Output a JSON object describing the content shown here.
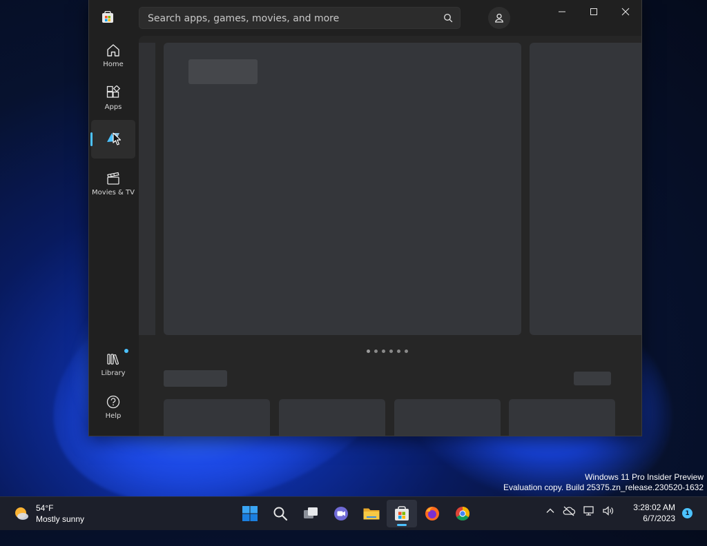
{
  "search": {
    "placeholder": "Search apps, games, movies, and more"
  },
  "sidebar": {
    "items": [
      {
        "label": "Home",
        "icon": "home-icon"
      },
      {
        "label": "Apps",
        "icon": "apps-icon"
      },
      {
        "label": "",
        "icon": "gaming-icon",
        "active": true
      },
      {
        "label": "Movies & TV",
        "icon": "movies-icon"
      }
    ],
    "bottom": [
      {
        "label": "Library",
        "icon": "library-icon"
      },
      {
        "label": "Help",
        "icon": "help-icon"
      }
    ]
  },
  "carousel": {
    "page_count": 6,
    "current_page": 1
  },
  "watermark": {
    "line1": "Windows 11 Pro Insider Preview",
    "line2": "Evaluation copy. Build 25375.zn_release.230520-1632"
  },
  "taskbar": {
    "weather_temp": "54°F",
    "weather_desc": "Mostly sunny",
    "time": "3:28:02 AM",
    "date": "6/7/2023",
    "notifications": "1"
  },
  "colors": {
    "accent": "#4cc2ff",
    "window_bg": "#202020",
    "content_bg": "#262626"
  }
}
